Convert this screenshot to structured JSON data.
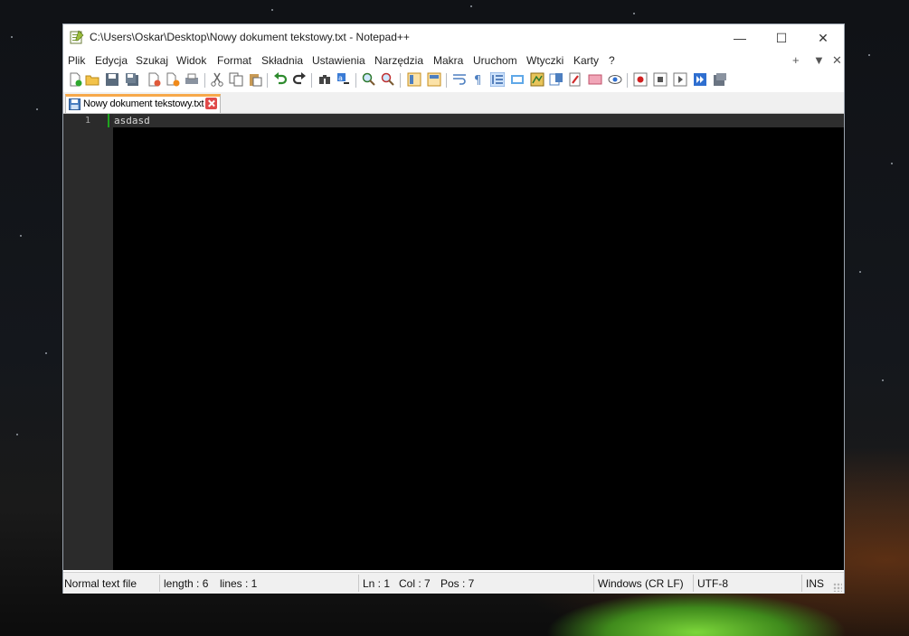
{
  "window": {
    "title": "C:\\Users\\Oskar\\Desktop\\Nowy dokument tekstowy.txt - Notepad++",
    "minimize_glyph": "—",
    "maximize_glyph": "☐",
    "close_glyph": "✕"
  },
  "menu": {
    "items": [
      "Plik",
      "Edycja",
      "Szukaj",
      "Widok",
      "Format",
      "Składnia",
      "Ustawienia",
      "Narzędzia",
      "Makra",
      "Uruchom",
      "Wtyczki",
      "Karty",
      "?"
    ],
    "right": [
      "+",
      "▼",
      "✕"
    ]
  },
  "toolbar": {
    "icons": [
      "new-file",
      "open-file",
      "save",
      "save-all",
      "close",
      "close-all",
      "print",
      "cut",
      "copy",
      "paste",
      "undo",
      "redo",
      "find",
      "replace",
      "zoom-in",
      "zoom-out",
      "sync-vertical",
      "sync-horizontal",
      "word-wrap",
      "show-all-chars",
      "indent-guide",
      "user-language",
      "document-map",
      "function-list",
      "folder-as-workspace",
      "monitoring",
      "doc-list",
      "eye",
      "record-macro",
      "stop-macro",
      "play-macro",
      "run-macro-multiple",
      "save-macro"
    ]
  },
  "tab": {
    "label": "Nowy dokument tekstowy.txt"
  },
  "editor": {
    "line_numbers": [
      "1"
    ],
    "lines": [
      "asdasd"
    ]
  },
  "status": {
    "file_type": "Normal text file",
    "length": "length : 6",
    "lines": "lines : 1",
    "ln": "Ln : 1",
    "col": "Col : 7",
    "pos": "Pos : 7",
    "eol": "Windows (CR LF)",
    "encoding": "UTF-8",
    "mode": "INS"
  },
  "colors": {
    "editor_bg": "#000000",
    "gutter_bg": "#2b2b2b",
    "tab_accent": "#f7a94a",
    "change_marker": "#1fa51f"
  }
}
